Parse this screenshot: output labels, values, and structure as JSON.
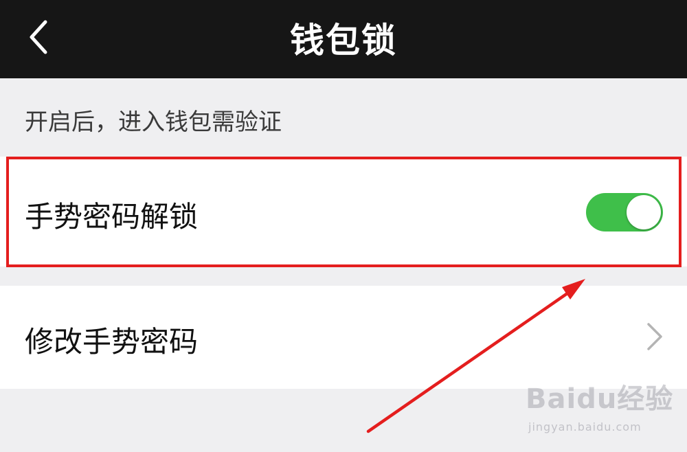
{
  "navbar": {
    "back_icon": "chevron-left-icon",
    "title": "钱包锁"
  },
  "description": "开启后，进入钱包需验证",
  "settings": [
    {
      "label": "手势密码解锁",
      "control": "toggle",
      "enabled": true,
      "toggle_color": "#3fbf4a"
    },
    {
      "label": "修改手势密码",
      "control": "chevron-right-icon"
    }
  ],
  "annotation": {
    "highlight_color": "#e41e1e",
    "highlighted_item": "手势密码解锁",
    "arrow_color": "#e41e1e"
  },
  "watermark": {
    "brand": "Baidu经验",
    "url": "jingyan.baidu.com"
  }
}
